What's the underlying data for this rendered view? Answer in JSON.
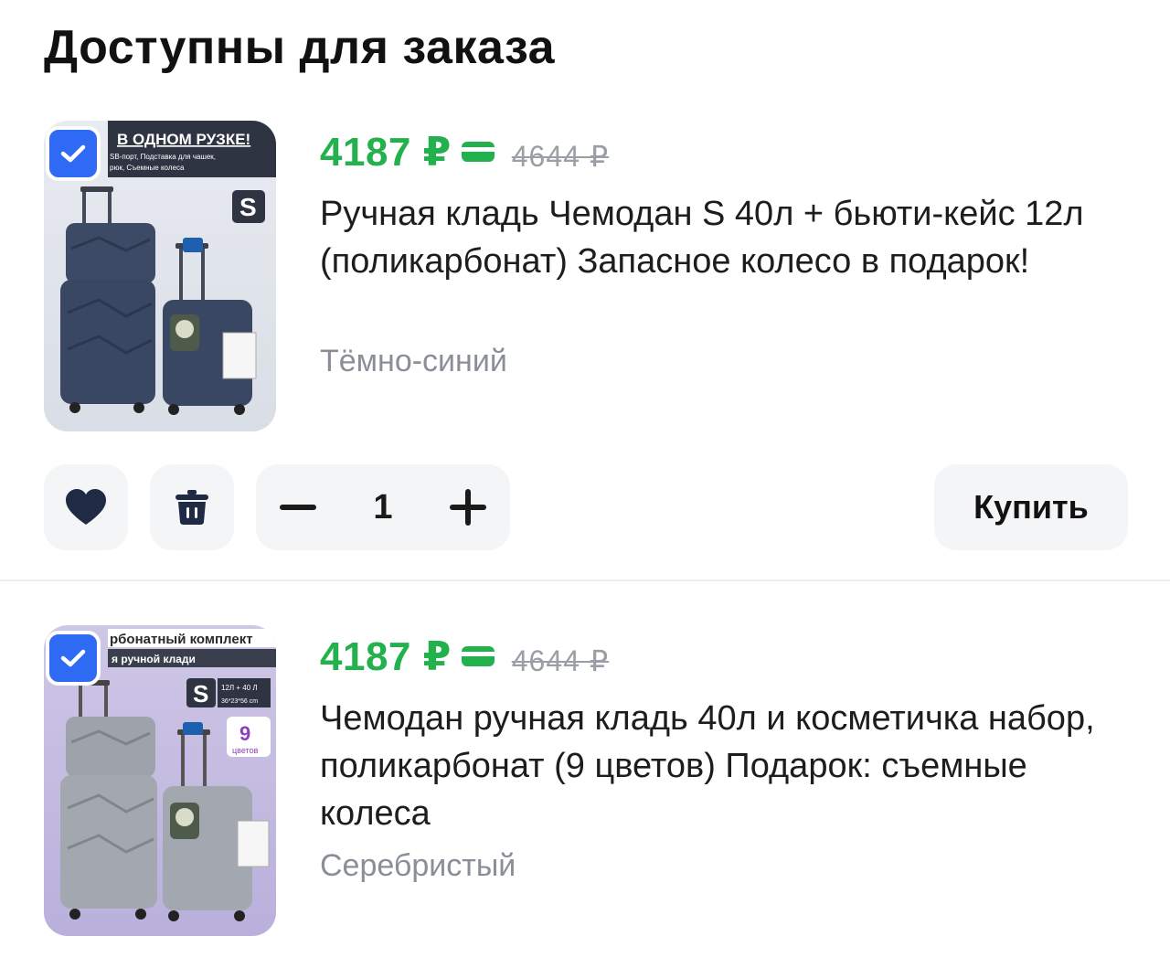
{
  "page": {
    "title": "Доступны для заказа"
  },
  "items": [
    {
      "price": "4187 ₽",
      "old_price": "4644 ₽",
      "name": "Ручная кладь Чемодан S 40л + бьюти-кейс 12л (поликарбонат) Запасное колесо в подарок!",
      "color": "Тёмно-синий",
      "image": {
        "banner_title": "В ОДНОМ РУЗКЕ!",
        "banner_line1": "SB-порт, Подставка для чашек,",
        "banner_line2": "рюк, Съемные колеса",
        "size_badge": "S"
      },
      "quantity": "1",
      "buy_label": "Купить"
    },
    {
      "price": "4187 ₽",
      "old_price": "4644 ₽",
      "name": "Чемодан ручная кладь 40л и косметичка набор, поликарбонат (9 цветов) Подарок: съемные колеса",
      "color": "Серебристый",
      "image": {
        "banner_title": "рбонатный комплект",
        "banner_line1": "я ручной клади",
        "size_badge": "S",
        "size_info1": "12Л + 40 Л",
        "size_info2": "36*23*56 cm",
        "colors_num": "9",
        "colors_word": "цветов"
      }
    }
  ],
  "colors": {
    "accent": "#2f6af5",
    "price": "#22b14c",
    "muted": "#8a8e96",
    "button_bg": "#f4f5f7"
  }
}
